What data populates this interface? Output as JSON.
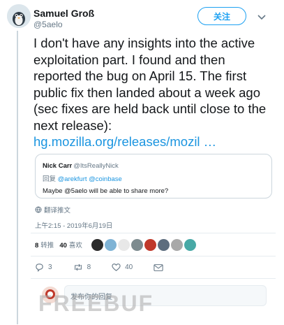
{
  "tweet": {
    "author_name": "Samuel Groß",
    "author_handle": "@5aelo",
    "follow_label": "关注",
    "text": "I don't have any insights into the active exploitation part. I found and then reported the bug on April 15. The first public fix then landed about a week ago (sec fixes are held back until close to the next release):",
    "link": "hg.mozilla.org/releases/mozil …",
    "translate_label": "翻译推文",
    "timestamp": "上午2:15 - 2019年6月19日"
  },
  "quote": {
    "name": "Nick Carr",
    "handle": "@ItsReallyNick",
    "reply_prefix": "回复",
    "reply_mentions": "@arekfurt @coinbase",
    "body": "Maybe @5aelo will be able to share more?"
  },
  "stats": {
    "retweets_count": "8",
    "retweets_label": "转推",
    "likes_count": "40",
    "likes_label": "喜欢"
  },
  "likers": [
    {
      "color": "#2b2b2b"
    },
    {
      "color": "#7fb3d5"
    },
    {
      "color": "#e8e8e8"
    },
    {
      "color": "#7d8b8f"
    },
    {
      "color": "#c0392b"
    },
    {
      "color": "#5d6d7e"
    },
    {
      "color": "#a9a9a9"
    },
    {
      "color": "#48a9a6"
    }
  ],
  "actions": {
    "reply_count": "3",
    "retweet_count": "8",
    "like_count": "40"
  },
  "reply_box": {
    "placeholder": "发布你的回复"
  },
  "watermark": "FREEBUF"
}
